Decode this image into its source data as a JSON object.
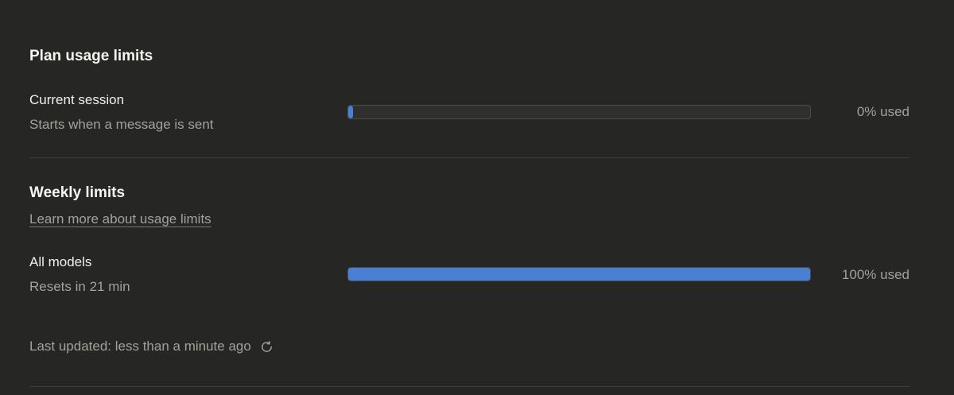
{
  "plan": {
    "title": "Plan usage limits",
    "current_session": {
      "label": "Current session",
      "subtitle": "Starts when a message is sent",
      "percent_used": 1,
      "percent_label": "0% used"
    }
  },
  "weekly": {
    "title": "Weekly limits",
    "learn_more_link": "Learn more about usage limits",
    "all_models": {
      "label": "All models",
      "subtitle": "Resets in 21 min",
      "percent_used": 100,
      "percent_label": "100% used"
    }
  },
  "footer": {
    "last_updated": "Last updated: less than a minute ago",
    "refresh_icon": "refresh-icon"
  },
  "colors": {
    "background": "#262624",
    "bar_fill": "#4a80d4",
    "bar_track": "#2f2f2d",
    "muted_text": "#a3a19a"
  }
}
